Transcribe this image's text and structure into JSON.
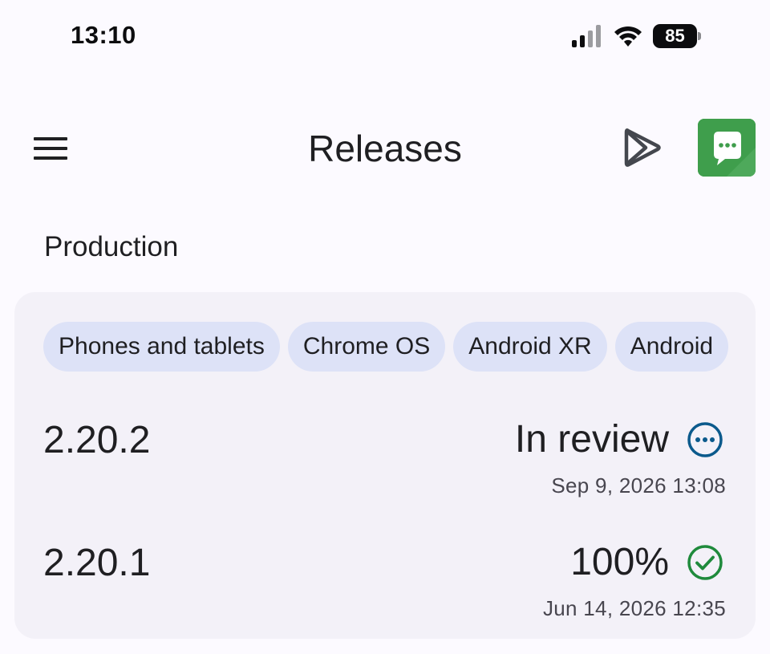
{
  "status_bar": {
    "time": "13:10",
    "battery": "85",
    "icons": [
      "signal-icon",
      "wifi-icon",
      "battery-icon"
    ]
  },
  "app_bar": {
    "title": "Releases",
    "icons": [
      "menu-icon",
      "google-play-icon",
      "feedback-chat-icon"
    ],
    "feedback_color": "#3c9b4a"
  },
  "section": {
    "label": "Production"
  },
  "chips": [
    {
      "label": "Phones and tablets"
    },
    {
      "label": "Chrome OS"
    },
    {
      "label": "Android XR"
    },
    {
      "label": "Android"
    }
  ],
  "releases": [
    {
      "version": "2.20.2",
      "status": "In review",
      "status_icon": "pending-dots-icon",
      "status_color": "#0b5a8c",
      "date": "Sep 9, 2026 13:08"
    },
    {
      "version": "2.20.1",
      "status": "100%",
      "status_icon": "check-circle-icon",
      "status_color": "#1f8a3c",
      "date": "Jun 14, 2026 12:35"
    }
  ],
  "colors": {
    "background": "#fcfaff",
    "card": "#f3f1f8",
    "chip": "#dde2f7"
  }
}
